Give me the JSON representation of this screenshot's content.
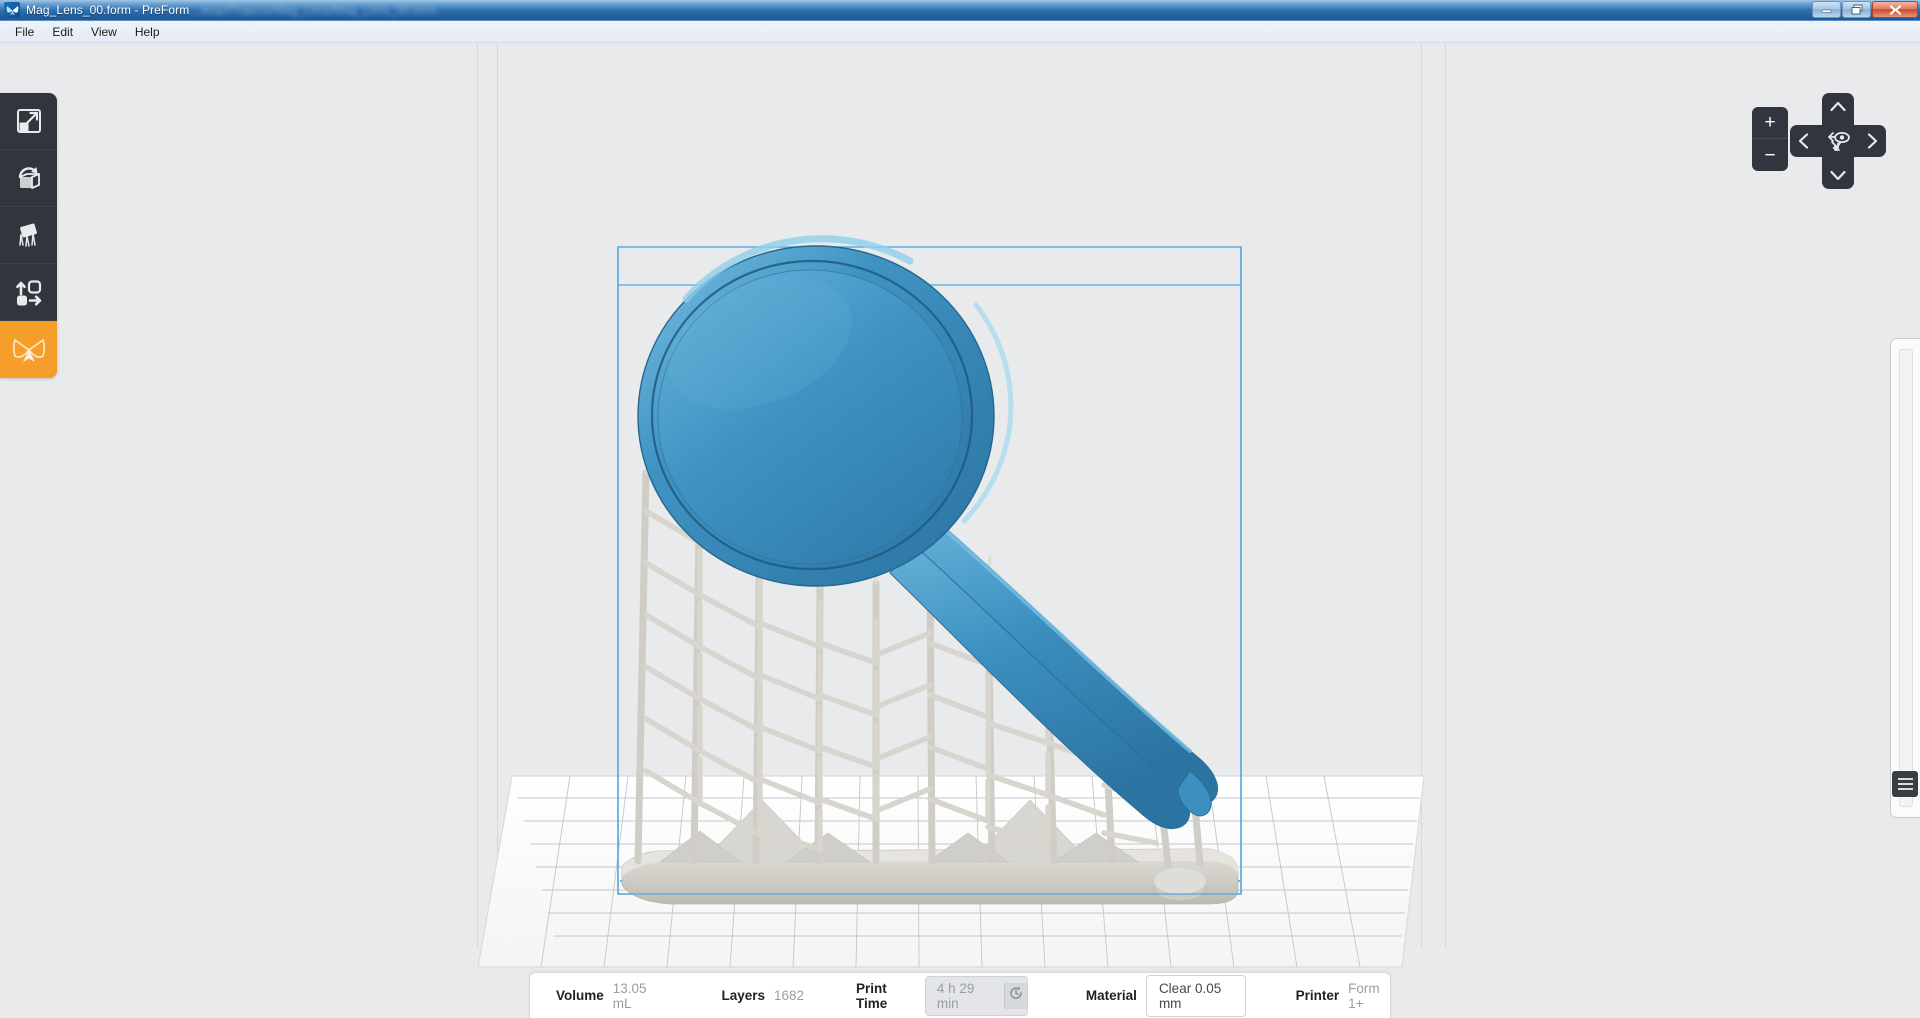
{
  "window": {
    "title": "Mag_Lens_00.form - PreForm",
    "blurred_path": "...ktop/Projects/Mag_Lens/Mag_Lens_00.form",
    "app_icon": "butterfly-logo-icon",
    "controls": {
      "minimize": "minimize-icon",
      "restore": "restore-icon",
      "close": "close-icon"
    }
  },
  "menubar": {
    "items": [
      {
        "label": "File"
      },
      {
        "label": "Edit"
      },
      {
        "label": "View"
      },
      {
        "label": "Help"
      }
    ]
  },
  "toolbar": {
    "items": [
      {
        "name": "size-tool",
        "icon": "scale-icon",
        "label": "Size",
        "active": false
      },
      {
        "name": "orientation-tool",
        "icon": "rotate-icon",
        "label": "Orientation",
        "active": false
      },
      {
        "name": "supports-tool",
        "icon": "supports-icon",
        "label": "Supports",
        "active": false
      },
      {
        "name": "layout-tool",
        "icon": "layout-icon",
        "label": "Layout",
        "active": false
      },
      {
        "name": "print-tool",
        "icon": "butterfly-icon",
        "label": "Print",
        "active": true
      }
    ]
  },
  "navigation": {
    "zoom_in": "+",
    "zoom_out": "−",
    "up": "chevron-up-icon",
    "down": "chevron-down-icon",
    "left": "chevron-left-icon",
    "right": "chevron-right-icon",
    "center": "orient-view-icon"
  },
  "right_panel": {
    "handle": "slider-handle-icon"
  },
  "status": {
    "volume_label": "Volume",
    "volume_value": "13.05 mL",
    "layers_label": "Layers",
    "layers_value": "1682",
    "print_time_label": "Print Time",
    "print_time_value": "4 h 29 min",
    "print_time_refresh_icon": "refresh-clock-icon",
    "material_label": "Material",
    "material_value": "Clear 0.05 mm",
    "printer_label": "Printer",
    "printer_value": "Form 1+"
  },
  "scene": {
    "model_name": "magnifying-glass-model",
    "model_color": "#3a8dbe",
    "model_color_dark": "#2d7ba8",
    "model_color_light": "#57a6d1",
    "support_color": "#d5d3cd",
    "platform_color": "#fdfdfd",
    "bounding_box_color": "#4da3dd",
    "background_color": "#e9eaec",
    "grid_color": "#b9bcc1"
  }
}
